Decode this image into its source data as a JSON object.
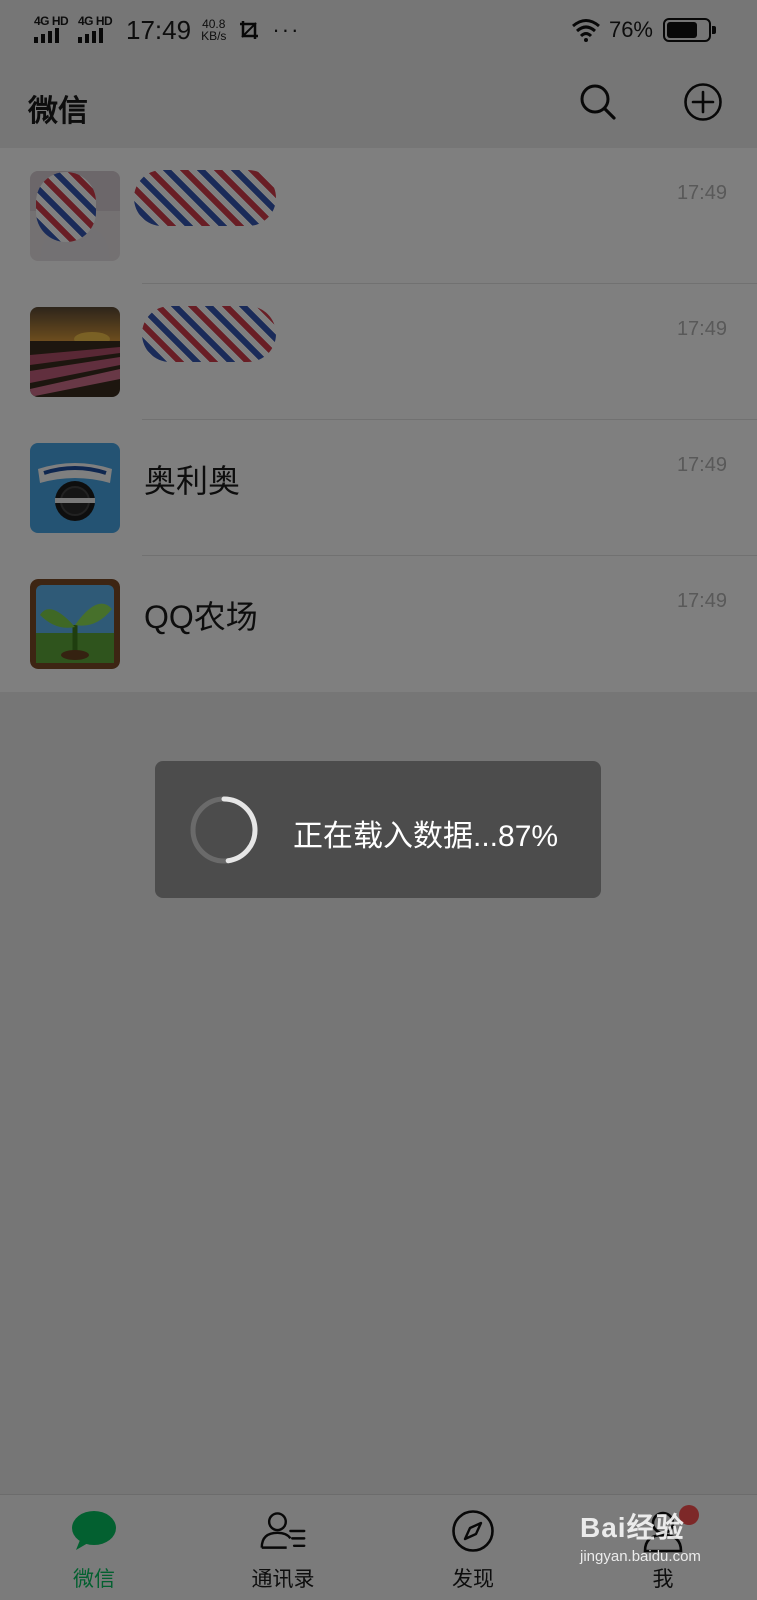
{
  "status_bar": {
    "network_1": "4G HD",
    "network_2": "4G HD",
    "time": "17:49",
    "speed_value": "40.8",
    "speed_unit": "KB/s",
    "more": "···",
    "battery_percent": "76%",
    "battery_level": 0.76
  },
  "header": {
    "title": "微信",
    "search_icon": "search-icon",
    "add_icon": "plus-circle-icon"
  },
  "chats": [
    {
      "name": "",
      "time": "17:49",
      "avatar": "portrait-photo",
      "name_redacted": true
    },
    {
      "name": "",
      "time": "17:49",
      "avatar": "tulip-field-photo",
      "name_redacted": true
    },
    {
      "name": "奥利奥",
      "time": "17:49",
      "avatar": "oreo-logo"
    },
    {
      "name": "QQ农场",
      "time": "17:49",
      "avatar": "qq-farm-sprout"
    }
  ],
  "loading": {
    "text": "正在载入数据...87%",
    "progress_percent": 87
  },
  "tabbar": {
    "tabs": [
      {
        "label": "微信",
        "icon": "chat-bubble-icon",
        "active": true
      },
      {
        "label": "通讯录",
        "icon": "contacts-icon",
        "active": false
      },
      {
        "label": "发现",
        "icon": "compass-icon",
        "active": false
      },
      {
        "label": "我",
        "icon": "person-icon",
        "active": false,
        "badge": true
      }
    ]
  },
  "watermark": {
    "logo": "Bai经验",
    "url": "jingyan.baidu.com"
  },
  "colors": {
    "accent_green": "#07c160",
    "badge_red": "#fa5151",
    "toast_bg": "#4c4c4c",
    "page_bg": "#ededed"
  }
}
